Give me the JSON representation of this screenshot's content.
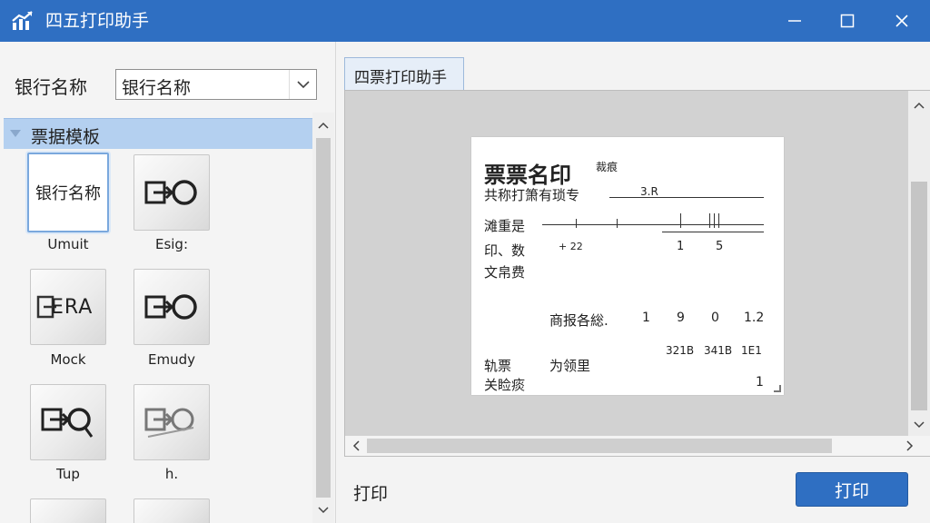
{
  "window": {
    "title": "四五打印助手",
    "icon": "chart-trend-icon",
    "controls": [
      "minimize-icon",
      "maximize-icon",
      "close-icon"
    ]
  },
  "left_panel": {
    "bank_label": "银行名称",
    "bank_select_value": "银行名称",
    "tree_header": "票据模板",
    "templates": [
      {
        "tile_text": "银行名称",
        "caption": "Umuit",
        "icon": "",
        "selected": true
      },
      {
        "tile_text": "",
        "caption": "Esig:",
        "icon": "export-circle-icon"
      },
      {
        "tile_text": "ERA",
        "caption": "Mock",
        "icon": "export-letters-icon"
      },
      {
        "tile_text": "",
        "caption": "Emudy",
        "icon": "export-circle-icon"
      },
      {
        "tile_text": "",
        "caption": "Tup",
        "icon": "export-magnifier-icon"
      },
      {
        "tile_text": "",
        "caption": "h.",
        "icon": "export-magnifier-faded-icon"
      }
    ]
  },
  "tab": {
    "label": "四票打印助手"
  },
  "preview": {
    "title": "票票名印",
    "title_tag": "裁痕",
    "row1_label": "共称打箫有琐专",
    "row1_value": "3.R",
    "row2_label": "滩重是",
    "row3_label": "印、数",
    "row3_mark": "+ 22",
    "row3_num1": "1",
    "row3_num2": "5",
    "row4_label": "文帛费",
    "row5_label": "商报各総.",
    "row5_values": [
      "1",
      "9",
      "0",
      "1.2"
    ],
    "row6_values": [
      "321B",
      "341B",
      "1E1"
    ],
    "row7_label": "轨票",
    "row7_value": "为领里",
    "row8_label": "关睑痰",
    "row8_value": "1"
  },
  "footer": {
    "print_label": "打印",
    "print_button": "打印"
  },
  "colors": {
    "accent": "#2f6fc2",
    "tree_highlight": "#b4d0f0"
  }
}
